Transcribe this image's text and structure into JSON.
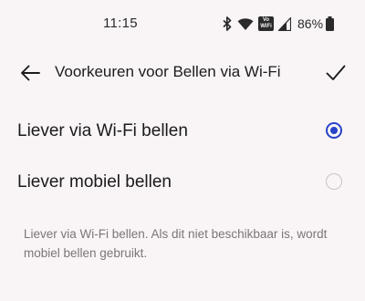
{
  "status_bar": {
    "time": "11:15",
    "vowifi_top": "Vo",
    "vowifi_bottom": "WiFi",
    "battery": "86%"
  },
  "app_bar": {
    "title": "Voorkeuren voor Bellen via Wi-Fi",
    "back_icon": "arrow-left-icon",
    "confirm_icon": "checkmark-icon"
  },
  "options": [
    {
      "label": "Liever via Wi-Fi bellen",
      "selected": true
    },
    {
      "label": "Liever mobiel bellen",
      "selected": false
    }
  ],
  "description": "Liever via Wi-Fi bellen. Als dit niet beschikbaar is, wordt mobiel bellen gebruikt.",
  "colors": {
    "accent": "#2744c9",
    "background": "#f9f5f6",
    "secondary_text": "#7a7678"
  }
}
